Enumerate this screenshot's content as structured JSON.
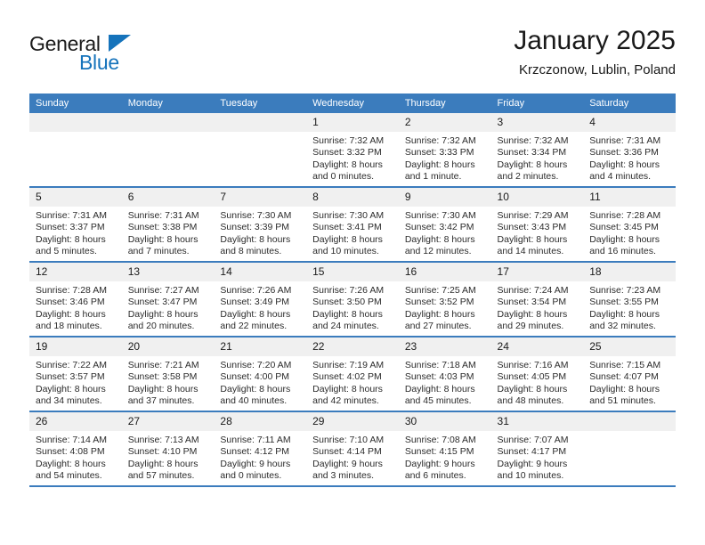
{
  "brand": {
    "name_top": "General",
    "name_bottom": "Blue",
    "triangle_color": "#1573bb",
    "text_color": "#1a1a1a"
  },
  "header": {
    "title": "January 2025",
    "subtitle": "Krzczonow, Lublin, Poland"
  },
  "theme": {
    "header_row_bg": "#3b7cbd",
    "header_row_text": "#ffffff",
    "daynum_bg": "#f0f0f0",
    "cell_bg": "#ffffff",
    "row_divider": "#3b7cbd",
    "body_text": "#2b2b2b"
  },
  "calendar": {
    "weekday_headers": [
      "Sunday",
      "Monday",
      "Tuesday",
      "Wednesday",
      "Thursday",
      "Friday",
      "Saturday"
    ],
    "weeks": [
      [
        {
          "day": "",
          "sunrise": "",
          "sunset": "",
          "daylight": ""
        },
        {
          "day": "",
          "sunrise": "",
          "sunset": "",
          "daylight": ""
        },
        {
          "day": "",
          "sunrise": "",
          "sunset": "",
          "daylight": ""
        },
        {
          "day": "1",
          "sunrise": "Sunrise: 7:32 AM",
          "sunset": "Sunset: 3:32 PM",
          "daylight": "Daylight: 8 hours and 0 minutes."
        },
        {
          "day": "2",
          "sunrise": "Sunrise: 7:32 AM",
          "sunset": "Sunset: 3:33 PM",
          "daylight": "Daylight: 8 hours and 1 minute."
        },
        {
          "day": "3",
          "sunrise": "Sunrise: 7:32 AM",
          "sunset": "Sunset: 3:34 PM",
          "daylight": "Daylight: 8 hours and 2 minutes."
        },
        {
          "day": "4",
          "sunrise": "Sunrise: 7:31 AM",
          "sunset": "Sunset: 3:36 PM",
          "daylight": "Daylight: 8 hours and 4 minutes."
        }
      ],
      [
        {
          "day": "5",
          "sunrise": "Sunrise: 7:31 AM",
          "sunset": "Sunset: 3:37 PM",
          "daylight": "Daylight: 8 hours and 5 minutes."
        },
        {
          "day": "6",
          "sunrise": "Sunrise: 7:31 AM",
          "sunset": "Sunset: 3:38 PM",
          "daylight": "Daylight: 8 hours and 7 minutes."
        },
        {
          "day": "7",
          "sunrise": "Sunrise: 7:30 AM",
          "sunset": "Sunset: 3:39 PM",
          "daylight": "Daylight: 8 hours and 8 minutes."
        },
        {
          "day": "8",
          "sunrise": "Sunrise: 7:30 AM",
          "sunset": "Sunset: 3:41 PM",
          "daylight": "Daylight: 8 hours and 10 minutes."
        },
        {
          "day": "9",
          "sunrise": "Sunrise: 7:30 AM",
          "sunset": "Sunset: 3:42 PM",
          "daylight": "Daylight: 8 hours and 12 minutes."
        },
        {
          "day": "10",
          "sunrise": "Sunrise: 7:29 AM",
          "sunset": "Sunset: 3:43 PM",
          "daylight": "Daylight: 8 hours and 14 minutes."
        },
        {
          "day": "11",
          "sunrise": "Sunrise: 7:28 AM",
          "sunset": "Sunset: 3:45 PM",
          "daylight": "Daylight: 8 hours and 16 minutes."
        }
      ],
      [
        {
          "day": "12",
          "sunrise": "Sunrise: 7:28 AM",
          "sunset": "Sunset: 3:46 PM",
          "daylight": "Daylight: 8 hours and 18 minutes."
        },
        {
          "day": "13",
          "sunrise": "Sunrise: 7:27 AM",
          "sunset": "Sunset: 3:47 PM",
          "daylight": "Daylight: 8 hours and 20 minutes."
        },
        {
          "day": "14",
          "sunrise": "Sunrise: 7:26 AM",
          "sunset": "Sunset: 3:49 PM",
          "daylight": "Daylight: 8 hours and 22 minutes."
        },
        {
          "day": "15",
          "sunrise": "Sunrise: 7:26 AM",
          "sunset": "Sunset: 3:50 PM",
          "daylight": "Daylight: 8 hours and 24 minutes."
        },
        {
          "day": "16",
          "sunrise": "Sunrise: 7:25 AM",
          "sunset": "Sunset: 3:52 PM",
          "daylight": "Daylight: 8 hours and 27 minutes."
        },
        {
          "day": "17",
          "sunrise": "Sunrise: 7:24 AM",
          "sunset": "Sunset: 3:54 PM",
          "daylight": "Daylight: 8 hours and 29 minutes."
        },
        {
          "day": "18",
          "sunrise": "Sunrise: 7:23 AM",
          "sunset": "Sunset: 3:55 PM",
          "daylight": "Daylight: 8 hours and 32 minutes."
        }
      ],
      [
        {
          "day": "19",
          "sunrise": "Sunrise: 7:22 AM",
          "sunset": "Sunset: 3:57 PM",
          "daylight": "Daylight: 8 hours and 34 minutes."
        },
        {
          "day": "20",
          "sunrise": "Sunrise: 7:21 AM",
          "sunset": "Sunset: 3:58 PM",
          "daylight": "Daylight: 8 hours and 37 minutes."
        },
        {
          "day": "21",
          "sunrise": "Sunrise: 7:20 AM",
          "sunset": "Sunset: 4:00 PM",
          "daylight": "Daylight: 8 hours and 40 minutes."
        },
        {
          "day": "22",
          "sunrise": "Sunrise: 7:19 AM",
          "sunset": "Sunset: 4:02 PM",
          "daylight": "Daylight: 8 hours and 42 minutes."
        },
        {
          "day": "23",
          "sunrise": "Sunrise: 7:18 AM",
          "sunset": "Sunset: 4:03 PM",
          "daylight": "Daylight: 8 hours and 45 minutes."
        },
        {
          "day": "24",
          "sunrise": "Sunrise: 7:16 AM",
          "sunset": "Sunset: 4:05 PM",
          "daylight": "Daylight: 8 hours and 48 minutes."
        },
        {
          "day": "25",
          "sunrise": "Sunrise: 7:15 AM",
          "sunset": "Sunset: 4:07 PM",
          "daylight": "Daylight: 8 hours and 51 minutes."
        }
      ],
      [
        {
          "day": "26",
          "sunrise": "Sunrise: 7:14 AM",
          "sunset": "Sunset: 4:08 PM",
          "daylight": "Daylight: 8 hours and 54 minutes."
        },
        {
          "day": "27",
          "sunrise": "Sunrise: 7:13 AM",
          "sunset": "Sunset: 4:10 PM",
          "daylight": "Daylight: 8 hours and 57 minutes."
        },
        {
          "day": "28",
          "sunrise": "Sunrise: 7:11 AM",
          "sunset": "Sunset: 4:12 PM",
          "daylight": "Daylight: 9 hours and 0 minutes."
        },
        {
          "day": "29",
          "sunrise": "Sunrise: 7:10 AM",
          "sunset": "Sunset: 4:14 PM",
          "daylight": "Daylight: 9 hours and 3 minutes."
        },
        {
          "day": "30",
          "sunrise": "Sunrise: 7:08 AM",
          "sunset": "Sunset: 4:15 PM",
          "daylight": "Daylight: 9 hours and 6 minutes."
        },
        {
          "day": "31",
          "sunrise": "Sunrise: 7:07 AM",
          "sunset": "Sunset: 4:17 PM",
          "daylight": "Daylight: 9 hours and 10 minutes."
        },
        {
          "day": "",
          "sunrise": "",
          "sunset": "",
          "daylight": ""
        }
      ]
    ]
  }
}
